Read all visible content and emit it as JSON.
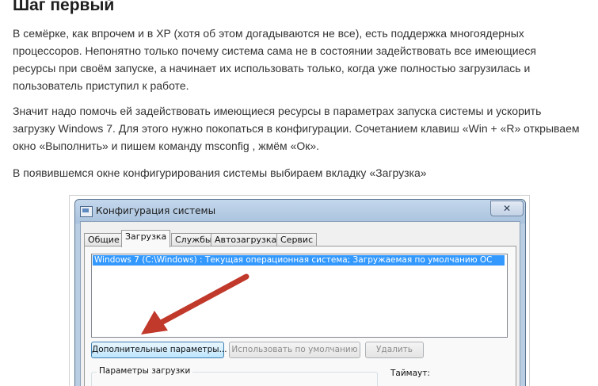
{
  "article": {
    "heading": "Шаг первый",
    "paragraph1": [
      "В семёрке, как впрочем и в XP (хотя об этом догадываются не все), есть поддержка многоядерных",
      "процессоров. Непонятно только почему система сама не в состоянии задействовать все имеющиеся",
      "ресурсы при своём запуске, а начинает их использовать только, когда уже полностью загрузилась и",
      "пользователь приступил к работе."
    ],
    "paragraph2": [
      "Значит надо помочь ей задействовать имеющиеся ресурсы в параметрах запуска системы и ускорить",
      "загрузку Windows 7. Для этого нужно покопаться в конфигурации. Сочетанием клавиш «Win + «R» открываем",
      "окно «Выполнить» и пишем команду msconfig , жмём «Ок»."
    ],
    "paragraph3": [
      "В появившемся окне конфигурирования системы выбираем вкладку «Загрузка»"
    ]
  },
  "dialog": {
    "title": "Конфигурация системы",
    "close_glyph": "✕",
    "tabs": [
      "Общие",
      "Загрузка",
      "Службы",
      "Автозагрузка",
      "Сервис"
    ],
    "active_tab": "Загрузка",
    "boot_entries": [
      "Windows 7 (C:\\Windows) : Текущая операционная система; Загружаемая по умолчанию ОС"
    ],
    "buttons": {
      "advanced": "Дополнительные параметры...",
      "set_default": "Использовать по умолчанию",
      "delete": "Удалить"
    },
    "boot_options_label": "Параметры загрузки",
    "timeout_label": "Таймаут:"
  },
  "annotation": {
    "arrow_color": "#c0392b",
    "selection_color": "#3399ff"
  }
}
